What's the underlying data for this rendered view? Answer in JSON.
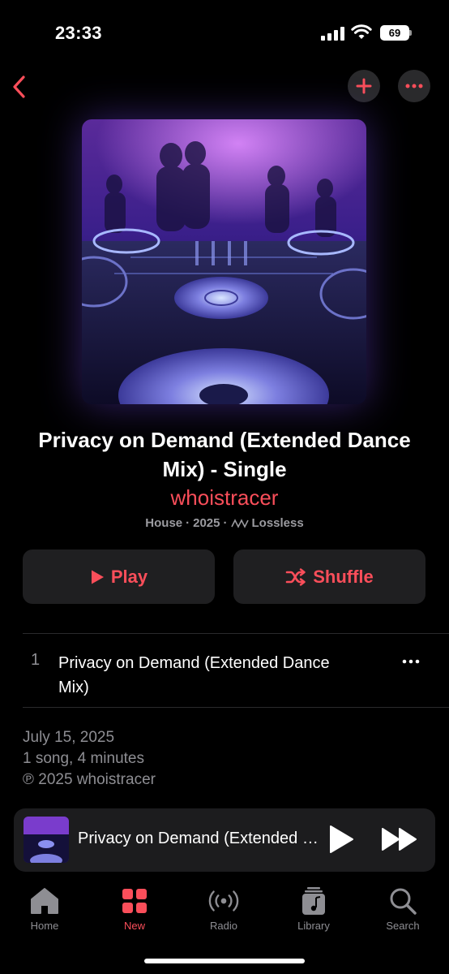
{
  "status_bar": {
    "time": "23:33",
    "battery": "69"
  },
  "album": {
    "title": "Privacy on Demand (Extended Dance Mix) - Single",
    "artist": "whoistracer",
    "genre": "House",
    "year": "2025",
    "quality": "Lossless",
    "separator": "·"
  },
  "actions": {
    "play_label": "Play",
    "shuffle_label": "Shuffle"
  },
  "tracks": [
    {
      "number": "1",
      "title": "Privacy on Demand (Extended Dance Mix)"
    }
  ],
  "info": {
    "release_date": "July 15, 2025",
    "summary": "1 song, 4 minutes",
    "copyright": "℗ 2025 whoistracer"
  },
  "now_playing": {
    "title": "Privacy on Demand (Extended Dance Mix)"
  },
  "tabs": [
    {
      "label": "Home",
      "icon": "home-icon"
    },
    {
      "label": "New",
      "icon": "grid-icon",
      "active": true
    },
    {
      "label": "Radio",
      "icon": "radio-icon"
    },
    {
      "label": "Library",
      "icon": "library-icon"
    },
    {
      "label": "Search",
      "icon": "search-icon"
    }
  ],
  "colors": {
    "accent": "#fa4e5a",
    "background": "#000000",
    "card": "#1f1f21",
    "secondary_text": "#8e8e93"
  }
}
